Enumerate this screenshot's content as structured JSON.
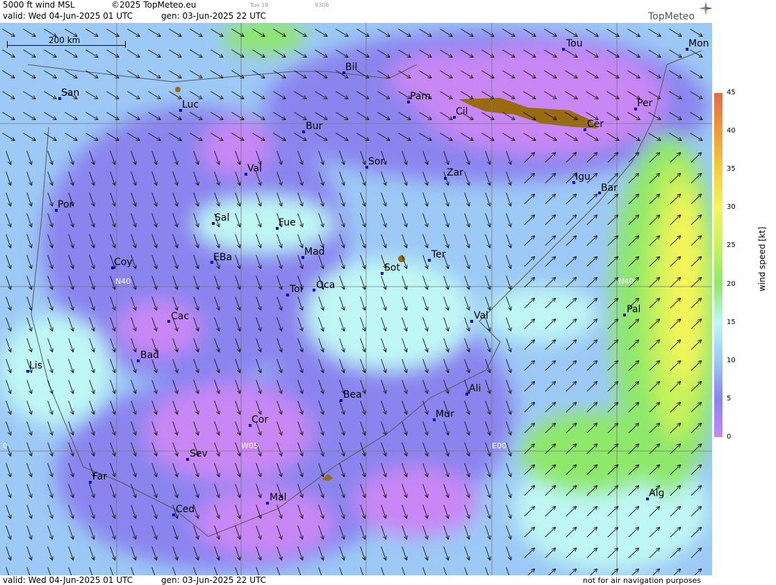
{
  "header": {
    "product": "5000 ft wind MSL",
    "copyright": "©2025 TopMeteo.eu",
    "day_tab": "Tue 18",
    "code": "9308",
    "valid": "valid:  Wed  04-Jun-2025  01 UTC",
    "gen": "gen: 03-Jun-2025 22 UTC",
    "brand": "TopMeteo"
  },
  "scale_bar": {
    "label": "200 km"
  },
  "footer": {
    "valid": "valid:  Wed  04-Jun-2025  01 UTC",
    "gen": "gen: 03-Jun-2025 22 UTC",
    "disclaimer": "not for air navigation purposes"
  },
  "legend": {
    "title": "wind speed [kt]",
    "ticks": [
      "45",
      "40",
      "35",
      "30",
      "25",
      "20",
      "15",
      "10",
      "5",
      "0"
    ],
    "colors": [
      "#e86a4a",
      "#ee9a3a",
      "#f2cf3c",
      "#f6f55a",
      "#c8f35a",
      "#8ee86a",
      "#bff7f5",
      "#9cc9f6",
      "#8a84ef",
      "#c887f5"
    ]
  },
  "grid_labels": {
    "n40_left": "N40",
    "n40_right": "N40",
    "w05": "W05",
    "e00": "E00",
    "w10": "0"
  },
  "cities": [
    {
      "name": "Tou"
    },
    {
      "name": "Mon"
    },
    {
      "name": "Bil"
    },
    {
      "name": "San"
    },
    {
      "name": "Luc"
    },
    {
      "name": "Pam"
    },
    {
      "name": "Per"
    },
    {
      "name": "Cil"
    },
    {
      "name": "Cer"
    },
    {
      "name": "Bur"
    },
    {
      "name": "Sor"
    },
    {
      "name": "Val"
    },
    {
      "name": "Zar"
    },
    {
      "name": "Igu"
    },
    {
      "name": "Bar"
    },
    {
      "name": "Por"
    },
    {
      "name": "Sal"
    },
    {
      "name": "Fue"
    },
    {
      "name": "Mad"
    },
    {
      "name": "EBa"
    },
    {
      "name": "Coy"
    },
    {
      "name": "Sot"
    },
    {
      "name": "Ter"
    },
    {
      "name": "Tol"
    },
    {
      "name": "Oca"
    },
    {
      "name": "Pal"
    },
    {
      "name": "Cac"
    },
    {
      "name": "Val"
    },
    {
      "name": "Bad"
    },
    {
      "name": "Lis"
    },
    {
      "name": "Bea"
    },
    {
      "name": "Ali"
    },
    {
      "name": "Mur"
    },
    {
      "name": "Cor"
    },
    {
      "name": "Sev"
    },
    {
      "name": "Far"
    },
    {
      "name": "Alg"
    },
    {
      "name": "Mal"
    },
    {
      "name": "Ced"
    }
  ]
}
